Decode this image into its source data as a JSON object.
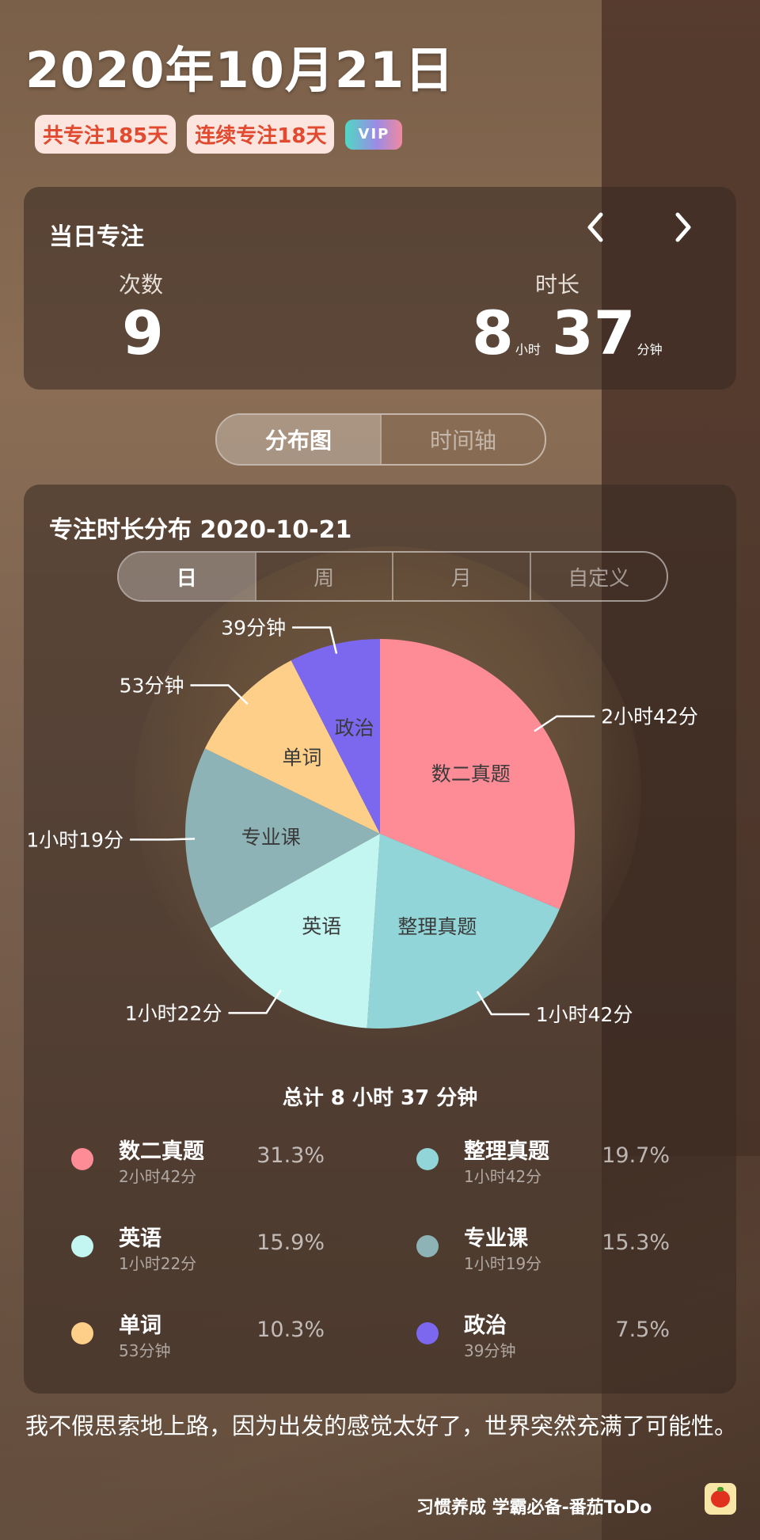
{
  "header": {
    "date": "2020年10月21日",
    "badges": [
      "共专注185天",
      "连续专注18天"
    ],
    "vip_label": "VIP"
  },
  "day_summary": {
    "title": "当日专注",
    "prev_icon": "chevron-left-icon",
    "next_icon": "chevron-right-icon",
    "count_label": "次数",
    "count_value": "9",
    "duration_label": "时长",
    "hours": "8",
    "hours_unit": "小时",
    "minutes": "37",
    "minutes_unit": "分钟"
  },
  "view_tabs": [
    {
      "label": "分布图",
      "active": true
    },
    {
      "label": "时间轴",
      "active": false
    }
  ],
  "distribution": {
    "title": "专注时长分布  2020-10-21",
    "range_tabs": [
      {
        "label": "日",
        "active": true
      },
      {
        "label": "周",
        "active": false
      },
      {
        "label": "月",
        "active": false
      },
      {
        "label": "自定义",
        "active": false
      }
    ],
    "total": "总计 8 小时 37 分钟"
  },
  "chart_data": {
    "type": "pie",
    "slices": [
      {
        "name": "数二真题",
        "minutes": 162,
        "duration": "2小时42分",
        "percent": "31.3%",
        "color": "#fe8c97"
      },
      {
        "name": "整理真题",
        "minutes": 102,
        "duration": "1小时42分",
        "percent": "19.7%",
        "color": "#92d5d8"
      },
      {
        "name": "英语",
        "minutes": 82,
        "duration": "1小时22分",
        "percent": "15.9%",
        "color": "#c3f6f1"
      },
      {
        "name": "专业课",
        "minutes": 79,
        "duration": "1小时19分",
        "percent": "15.3%",
        "color": "#8db3b7"
      },
      {
        "name": "单词",
        "minutes": 53,
        "duration": "53分钟",
        "percent": "10.3%",
        "color": "#fecf89"
      },
      {
        "name": "政治",
        "minutes": 39,
        "duration": "39分钟",
        "percent": "7.5%",
        "color": "#7c68ee"
      }
    ]
  },
  "footer": {
    "quote": "我不假思索地上路，因为出发的感觉太好了，世界突然充满了可能性。",
    "app_text": "习惯养成 学霸必备-番茄ToDo",
    "app_icon": "tomato-icon"
  }
}
